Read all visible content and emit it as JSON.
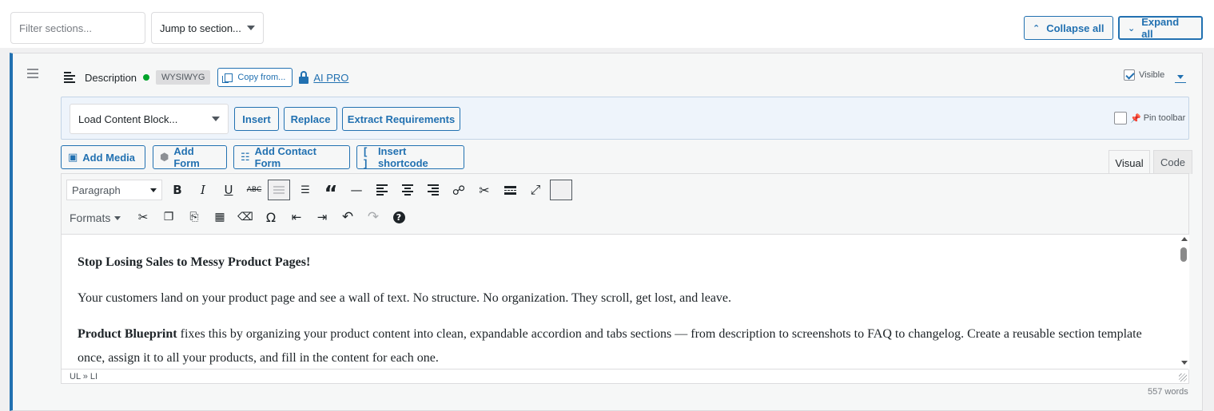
{
  "topbar": {
    "filter_placeholder": "Filter sections...",
    "jump_label": "Jump to section...",
    "collapse_all": "Collapse all",
    "expand_all": "Expand all"
  },
  "section": {
    "title": "Description",
    "type_badge": "WYSIWYG",
    "copy_label": "Copy from...",
    "ai_label": "AI PRO",
    "visible_label": "Visible",
    "visible_checked": true
  },
  "block_bar": {
    "select_label": "Load Content Block...",
    "insert": "Insert",
    "replace": "Replace",
    "extract": "Extract Requirements",
    "pin_label": "Pin toolbar"
  },
  "media_buttons": {
    "add_media": "Add Media",
    "add_form": "Add Form",
    "add_contact_form": "Add Contact Form",
    "insert_shortcode": "Insert shortcode"
  },
  "tabs": {
    "visual": "Visual",
    "code": "Code"
  },
  "toolbar": {
    "format_select": "Paragraph",
    "formats": "Formats",
    "row1_icons": [
      "bold-icon",
      "italic-icon",
      "underline-icon",
      "strikethrough-icon",
      "bullet-list-icon",
      "numbered-list-icon",
      "blockquote-icon",
      "horizontal-rule-icon",
      "align-left-icon",
      "align-center-icon",
      "align-right-icon",
      "link-icon",
      "unlink-icon",
      "read-more-icon",
      "fullscreen-icon",
      "toolbar-toggle-icon"
    ],
    "row2_icons": [
      "cut-icon",
      "copy-icon",
      "paste-icon",
      "paste-as-text-icon",
      "clear-formatting-icon",
      "special-character-icon",
      "outdent-icon",
      "indent-icon",
      "undo-icon",
      "redo-icon",
      "help-icon"
    ]
  },
  "content": {
    "headline": "Stop Losing Sales to Messy Product Pages!",
    "para1": "Your customers land on your product page and see a wall of text. No structure. No organization. They scroll, get lost, and leave.",
    "para2_bold": "Product Blueprint",
    "para2_rest": " fixes this by organizing your product content into clean, expandable accordion and tabs sections — from description to screenshots to FAQ to changelog. Create a reusable section template once, assign it to all your products, and fill in the content for each one."
  },
  "status_path": "UL » LI",
  "word_count": "557 words",
  "colors": {
    "accent": "#2271b1",
    "status_ok": "#00a32a"
  }
}
